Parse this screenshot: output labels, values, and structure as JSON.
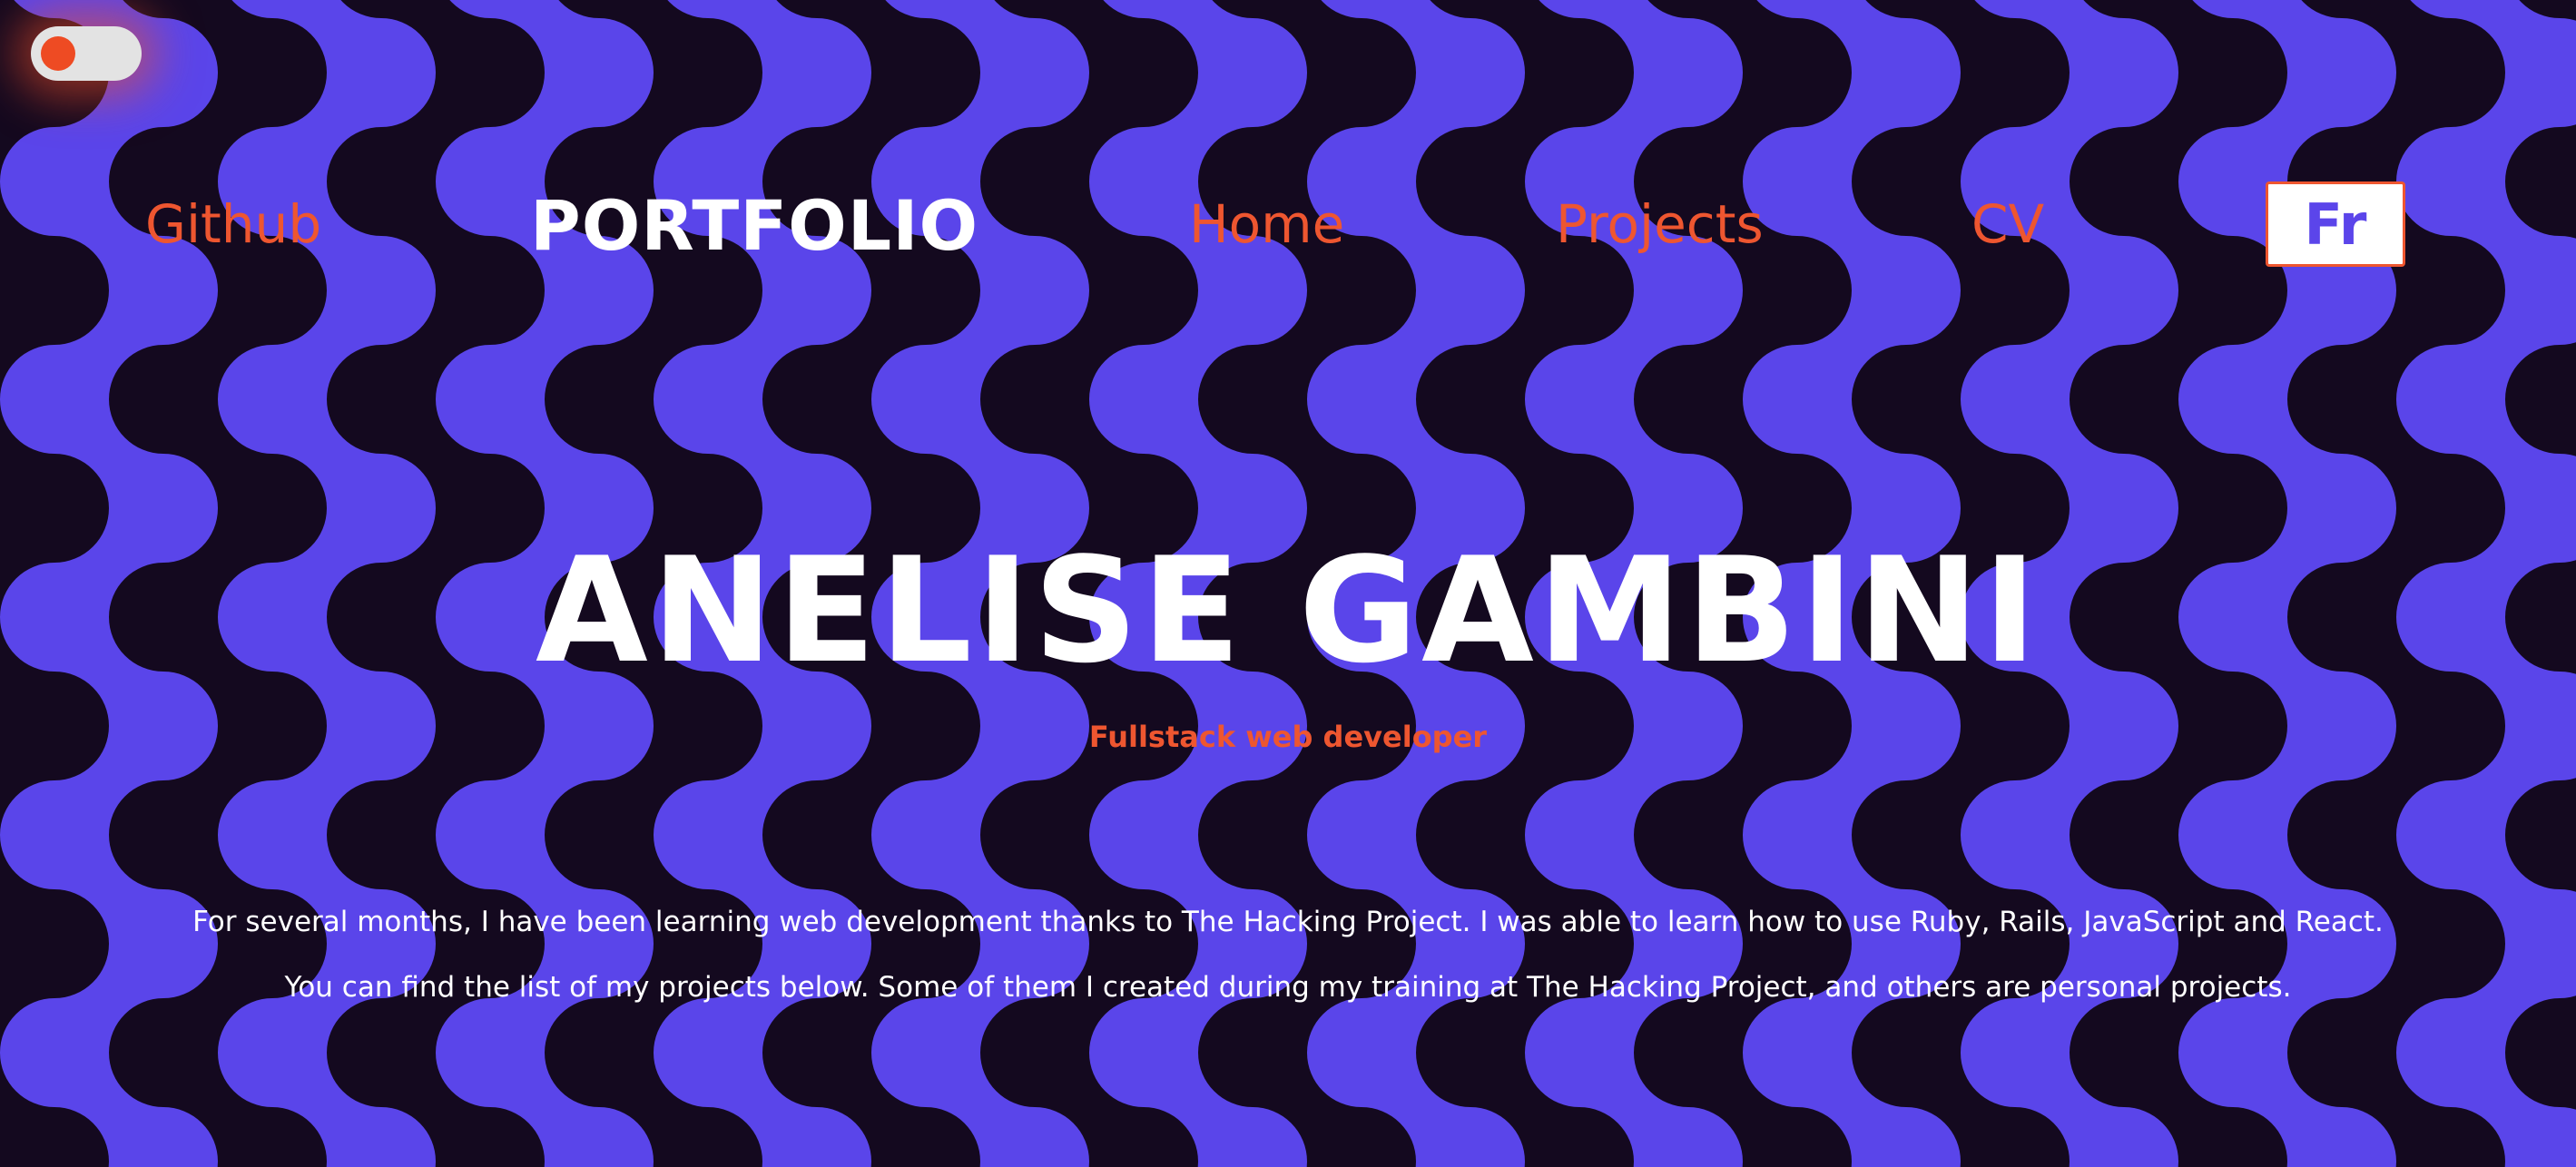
{
  "theme": {
    "background_dark": "#14091f",
    "background_wave": "#5a45ea",
    "accent": "#ee5630",
    "text": "#ffffff"
  },
  "toggle": {
    "icon": "toggle-switch-icon"
  },
  "nav": {
    "github": "Github",
    "brand": "PORTFOLIO",
    "home": "Home",
    "projects": "Projects",
    "cv": "CV",
    "language_button": "Fr"
  },
  "hero": {
    "name": "ANELISE GAMBINI",
    "subtitle": "Fullstack web developer",
    "paragraph_1": "For several months, I have been learning web development thanks to The Hacking Project. I was able to learn how to use Ruby, Rails, JavaScript and React.",
    "paragraph_2": "You can find the list of my projects below. Some of them I created during my training at The Hacking Project, and others are personal projects."
  }
}
